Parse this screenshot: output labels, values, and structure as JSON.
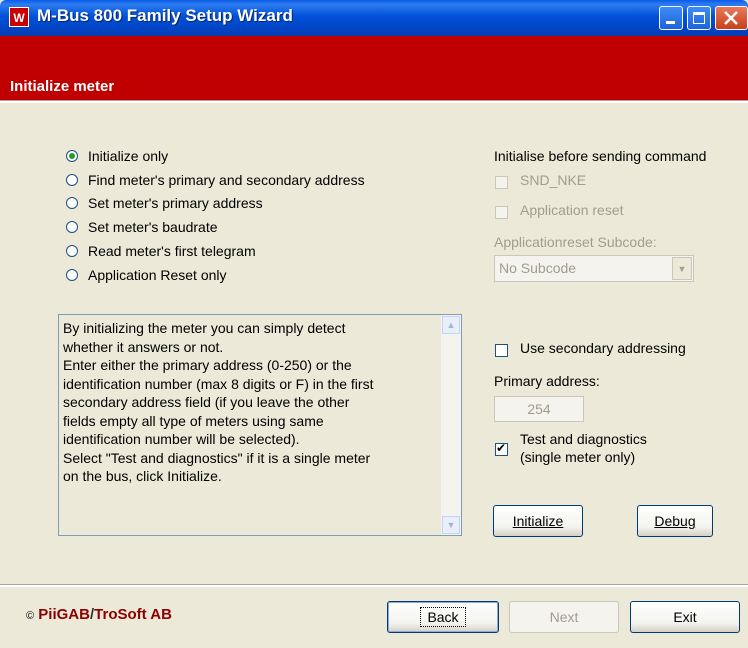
{
  "window": {
    "title": "M-Bus 800 Family Setup Wizard",
    "icon_letter": "W"
  },
  "header": {
    "title": "Initialize meter"
  },
  "modes": [
    {
      "label": "Initialize only",
      "selected": true
    },
    {
      "label": "Find meter's primary and secondary address",
      "selected": false
    },
    {
      "label": "Set meter's primary address",
      "selected": false
    },
    {
      "label": "Set meter's baudrate",
      "selected": false
    },
    {
      "label": "Read meter's first telegram",
      "selected": false
    },
    {
      "label": "Application Reset only",
      "selected": false
    }
  ],
  "description": [
    "By initializing the meter you can simply detect",
    "whether it answers or not.",
    "Enter either the primary address (0-250) or the",
    "identification number (max 8 digits or F) in the first",
    "secondary address field (if you leave the other",
    "fields empty all type of meters using same",
    "identification number will be selected).",
    "Select \"Test and diagnostics\" if it is a single meter",
    "on the bus, click Initialize."
  ],
  "init_before": {
    "heading": "Initialise before sending command",
    "snd_nke": {
      "label": "SND_NKE",
      "checked": false,
      "enabled": false
    },
    "app_reset": {
      "label": "Application reset",
      "checked": false,
      "enabled": false
    },
    "subcode_label": "Applicationreset Subcode:",
    "subcode_value": "No Subcode"
  },
  "secondary_addressing": {
    "label": "Use secondary addressing",
    "checked": false
  },
  "primary_address": {
    "label": "Primary address:",
    "value": "254"
  },
  "test_diag": {
    "label_line1": "Test and diagnostics",
    "label_line2": "(single meter only)",
    "checked": true
  },
  "buttons": {
    "initialize": "Initialize",
    "debug": "Debug",
    "back": "Back",
    "next": "Next",
    "exit": "Exit"
  },
  "footer": {
    "copyright": "©",
    "company1": "PiiGAB",
    "separator": "/",
    "company2": "TroSoft AB"
  },
  "colors": {
    "header_bg": "#c00000",
    "titlebar": "#0052d9",
    "window_bg": "#ece9d8",
    "footer_text": "#8b0000"
  }
}
